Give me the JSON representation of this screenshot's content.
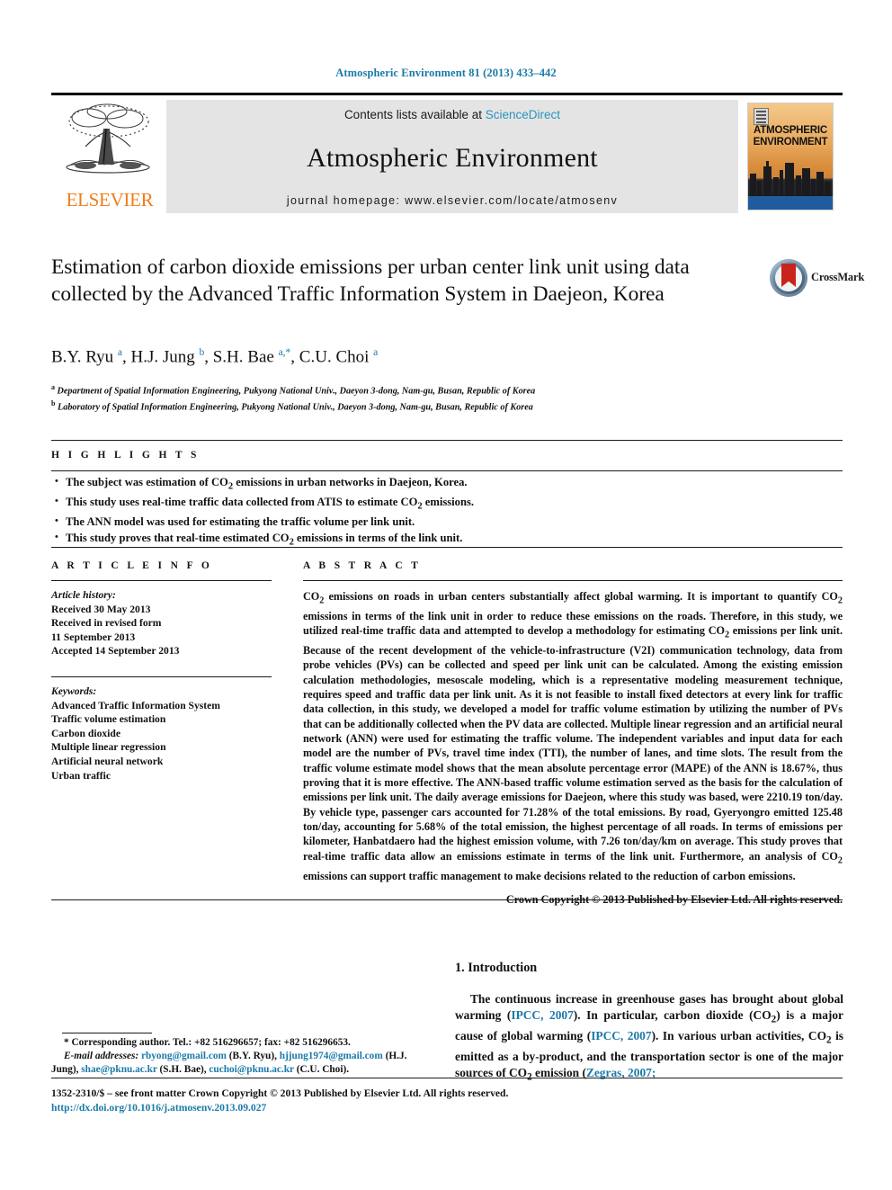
{
  "running_head": "Atmospheric Environment 81 (2013) 433–442",
  "masthead": {
    "publisher": "ELSEVIER",
    "contents_prefix": "Contents lists available at ",
    "contents_link": "ScienceDirect",
    "journal_name": "Atmospheric Environment",
    "homepage": "journal homepage: www.elsevier.com/locate/atmosenv",
    "cover_title_line1": "ATMOSPHERIC",
    "cover_title_line2": "ENVIRONMENT"
  },
  "article": {
    "title": "Estimation of carbon dioxide emissions per urban center link unit using data collected by the Advanced Traffic Information System in Daejeon, Korea",
    "crossmark_label": "CrossMark",
    "authors": "B.Y. Ryu a, H.J. Jung b, S.H. Bae a,*, C.U. Choi a",
    "affiliation_a": "a Department of Spatial Information Engineering, Pukyong National Univ., Daeyon 3-dong, Nam-gu, Busan, Republic of Korea",
    "affiliation_b": "b Laboratory of Spatial Information Engineering, Pukyong National Univ., Daeyon 3-dong, Nam-gu, Busan, Republic of Korea"
  },
  "highlights": {
    "heading": "H I G H L I G H T S",
    "items": [
      "The subject was estimation of CO2 emissions in urban networks in Daejeon, Korea.",
      "This study uses real-time traffic data collected from ATIS to estimate CO2 emissions.",
      "The ANN model was used for estimating the traffic volume per link unit.",
      "This study proves that real-time estimated CO2 emissions in terms of the link unit."
    ]
  },
  "article_info": {
    "heading": "A R T I C L E   I N F O",
    "history_label": "Article history:",
    "history": [
      "Received 30 May 2013",
      "Received in revised form",
      "11 September 2013",
      "Accepted 14 September 2013"
    ],
    "keywords_label": "Keywords:",
    "keywords": [
      "Advanced Traffic Information System",
      "Traffic volume estimation",
      "Carbon dioxide",
      "Multiple linear regression",
      "Artificial neural network",
      "Urban traffic"
    ]
  },
  "abstract": {
    "heading": "A B S T R A C T",
    "text": "CO2 emissions on roads in urban centers substantially affect global warming. It is important to quantify CO2 emissions in terms of the link unit in order to reduce these emissions on the roads. Therefore, in this study, we utilized real-time traffic data and attempted to develop a methodology for estimating CO2 emissions per link unit. Because of the recent development of the vehicle-to-infrastructure (V2I) communication technology, data from probe vehicles (PVs) can be collected and speed per link unit can be calculated. Among the existing emission calculation methodologies, mesoscale modeling, which is a representative modeling measurement technique, requires speed and traffic data per link unit. As it is not feasible to install fixed detectors at every link for traffic data collection, in this study, we developed a model for traffic volume estimation by utilizing the number of PVs that can be additionally collected when the PV data are collected. Multiple linear regression and an artificial neural network (ANN) were used for estimating the traffic volume. The independent variables and input data for each model are the number of PVs, travel time index (TTI), the number of lanes, and time slots. The result from the traffic volume estimate model shows that the mean absolute percentage error (MAPE) of the ANN is 18.67%, thus proving that it is more effective. The ANN-based traffic volume estimation served as the basis for the calculation of emissions per link unit. The daily average emissions for Daejeon, where this study was based, were 2210.19 ton/day. By vehicle type, passenger cars accounted for 71.28% of the total emissions. By road, Gyeryongro emitted 125.48 ton/day, accounting for 5.68% of the total emission, the highest percentage of all roads. In terms of emissions per kilometer, Hanbatdaero had the highest emission volume, with 7.26 ton/day/km on average. This study proves that real-time traffic data allow an emissions estimate in terms of the link unit. Furthermore, an analysis of CO2 emissions can support traffic management to make decisions related to the reduction of carbon emissions.",
    "copyright": "Crown Copyright © 2013 Published by Elsevier Ltd. All rights reserved."
  },
  "introduction": {
    "heading": "1. Introduction",
    "paragraph_part1": "The continuous increase in greenhouse gases has brought about global warming (",
    "ref1": "IPCC, 2007",
    "paragraph_part2": "). In particular, carbon dioxide (CO2) is a major cause of global warming (",
    "ref2": "IPCC, 2007",
    "paragraph_part3": "). In various urban activities, CO2 is emitted as a by-product, and the transportation sector is one of the major sources of CO2 emission (",
    "ref3": "Zegras, 2007;"
  },
  "footnote": {
    "corresponding": "* Corresponding author. Tel.: +82 516296657; fax: +82 516296653.",
    "email_label": "E-mail addresses:",
    "emails": [
      {
        "address": "rbyong@gmail.com",
        "name": "(B.Y. Ryu),"
      },
      {
        "address": "hjjung1974@gmail.com",
        "name": "(H.J. Jung),"
      },
      {
        "address": "shae@pknu.ac.kr",
        "name": "(S.H. Bae),"
      },
      {
        "address": "cuchoi@pknu.ac.kr",
        "name": "(C.U. Choi)."
      }
    ]
  },
  "footer": {
    "issn_line": "1352-2310/$ – see front matter Crown Copyright © 2013 Published by Elsevier Ltd. All rights reserved.",
    "doi": "http://dx.doi.org/10.1016/j.atmosenv.2013.09.027"
  }
}
